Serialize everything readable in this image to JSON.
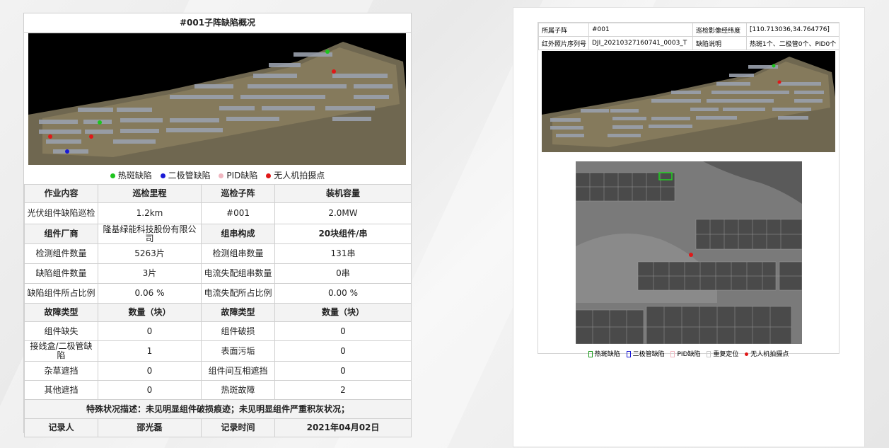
{
  "report": {
    "title": "#001子阵缺陷概况",
    "legend": [
      {
        "label": "热斑缺陷",
        "color": "#1ec41e"
      },
      {
        "label": "二极管缺陷",
        "color": "#1a1ad6"
      },
      {
        "label": "PID缺陷",
        "color": "#f0b6c0"
      },
      {
        "label": "无人机拍摄点",
        "color": "#e01818"
      }
    ],
    "header_row": [
      "作业内容",
      "巡检里程",
      "巡检子阵",
      "装机容量"
    ],
    "row1": [
      "光伏组件缺陷巡检",
      "1.2km",
      "#001",
      "2.0MW"
    ],
    "row2": [
      "组件厂商",
      "隆基绿能科技股份有限公司",
      "组串构成",
      "20块组件/串"
    ],
    "row3": [
      "检测组件数量",
      "5263片",
      "检测组串数量",
      "131串"
    ],
    "row4": [
      "缺陷组件数量",
      "3片",
      "电流失配组串数量",
      "0串"
    ],
    "row5": [
      "缺陷组件所占比例",
      "0.06 %",
      "电流失配所占比例",
      "0.00 %"
    ],
    "row6": [
      "故障类型",
      "数量（块）",
      "故障类型",
      "数量（块）"
    ],
    "row7": [
      "组件缺失",
      "0",
      "组件破损",
      "0"
    ],
    "row8": [
      "接线盒/二极管缺陷",
      "1",
      "表面污垢",
      "0"
    ],
    "row9": [
      "杂草遮挡",
      "0",
      "组件间互相遮挡",
      "0"
    ],
    "row10": [
      "其他遮挡",
      "0",
      "热斑故障",
      "2"
    ],
    "special": "特殊状况描述：未见明显组件破损痕迹；未见明显组件严重积灰状况；",
    "footer": [
      "记录人",
      "邵光磊",
      "记录时间",
      "2021年04月02日"
    ]
  },
  "detail": {
    "row1": [
      "所属子阵",
      "#001",
      "巡检影像经纬度",
      "[110.713036,34.764776]"
    ],
    "row2": [
      "红外照片序列号",
      "DJI_20210327160741_0003_T",
      "缺陷说明",
      "热斑1个、二极管0个、PID0个"
    ],
    "legend": [
      {
        "label": "热斑缺陷",
        "color": "#1a9a1a",
        "shape": "square"
      },
      {
        "label": "二极管缺陷",
        "color": "#1a1ad6",
        "shape": "square"
      },
      {
        "label": "PID缺陷",
        "color": "#f0b6c0",
        "shape": "square"
      },
      {
        "label": "重复定位",
        "color": "#c8c8c8",
        "shape": "square"
      },
      {
        "label": "无人机拍摄点",
        "color": "#e01818",
        "shape": "dot"
      }
    ]
  }
}
